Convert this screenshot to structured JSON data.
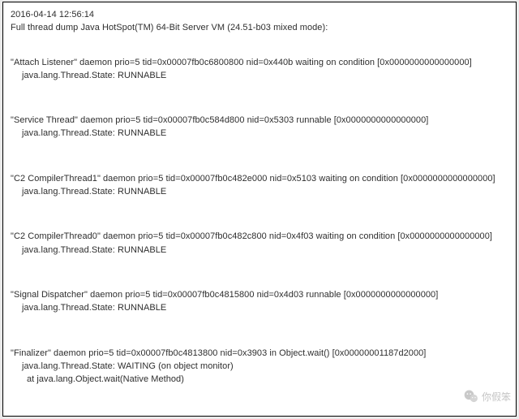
{
  "header": {
    "timestamp": "2016-04-14 12:56:14",
    "title": "Full thread dump Java HotSpot(TM) 64-Bit Server VM (24.51-b03 mixed mode):"
  },
  "threads": [
    {
      "line": "\"Attach Listener\" daemon prio=5 tid=0x00007fb0c6800800 nid=0x440b waiting on condition [0x0000000000000000]",
      "state": "java.lang.Thread.State: RUNNABLE"
    },
    {
      "line": "\"Service Thread\" daemon prio=5 tid=0x00007fb0c584d800 nid=0x5303 runnable [0x0000000000000000]",
      "state": "java.lang.Thread.State: RUNNABLE"
    },
    {
      "line": "\"C2 CompilerThread1\" daemon prio=5 tid=0x00007fb0c482e000 nid=0x5103 waiting on condition [0x0000000000000000]",
      "state": "java.lang.Thread.State: RUNNABLE"
    },
    {
      "line": "\"C2 CompilerThread0\" daemon prio=5 tid=0x00007fb0c482c800 nid=0x4f03 waiting on condition [0x0000000000000000]",
      "state": "java.lang.Thread.State: RUNNABLE"
    },
    {
      "line": "\"Signal Dispatcher\" daemon prio=5 tid=0x00007fb0c4815800 nid=0x4d03 runnable [0x0000000000000000]",
      "state": "java.lang.Thread.State: RUNNABLE"
    },
    {
      "line": "\"Finalizer\" daemon prio=5 tid=0x00007fb0c4813800 nid=0x3903 in Object.wait() [0x00000001187d2000]",
      "state": "java.lang.Thread.State: WAITING (on object monitor)",
      "trace0": "at java.lang.Object.wait(Native Method)"
    }
  ],
  "watermark": {
    "text": "你假笨"
  }
}
